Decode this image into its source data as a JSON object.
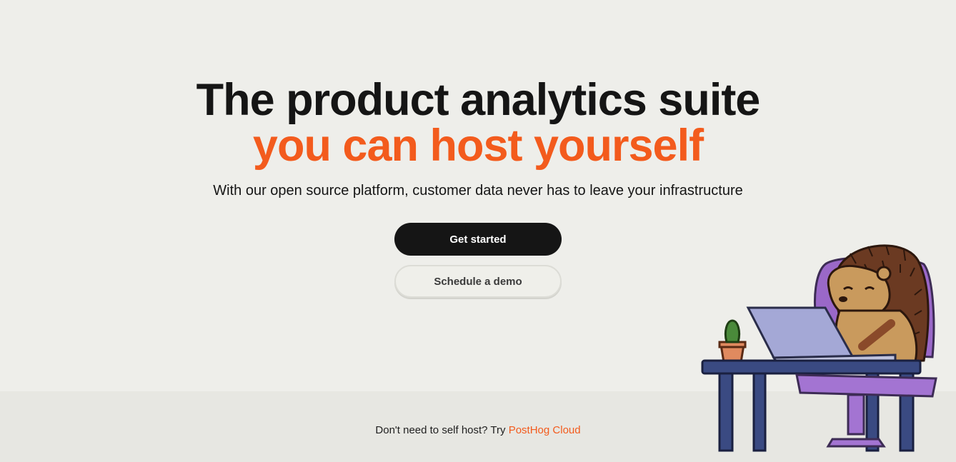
{
  "hero": {
    "title_line_1": "The product analytics suite",
    "title_line_2": "you can host yourself",
    "subtitle": "With our open source platform, customer data never has to leave your infrastructure"
  },
  "buttons": {
    "get_started": "Get started",
    "schedule_demo": "Schedule a demo"
  },
  "footer": {
    "prefix": "Don't need to self host? Try ",
    "link_text": "PostHog Cloud"
  },
  "illustration": {
    "icon": "hedgehog-at-laptop-illustration"
  },
  "colors": {
    "background": "#eeeeea",
    "accent": "#f35b1d",
    "text": "#151515",
    "primary_button": "#151515"
  }
}
